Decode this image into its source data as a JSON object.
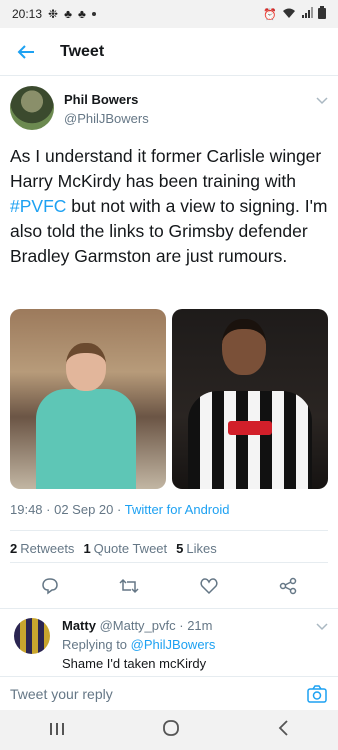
{
  "status_bar": {
    "time": "20:13"
  },
  "header": {
    "title": "Tweet"
  },
  "tweet": {
    "author_name": "Phil Bowers",
    "author_handle": "@PhilJBowers",
    "text_before": "As I understand it former Carlisle winger Harry McKirdy has been training with ",
    "hashtag": "#PVFC",
    "text_after": " but not with a view to signing. I'm also told the links to Grimsby defender Bradley Garmston are just rumours.",
    "media": [
      {
        "name": "image-left",
        "description": "Player in teal kit"
      },
      {
        "name": "image-right",
        "description": "Player in black-and-white striped kit"
      }
    ],
    "time": "19:48",
    "date": "02 Sep 20",
    "separator": " · ",
    "source": "Twitter for Android",
    "stats": {
      "retweets": "2",
      "retweets_label": "Retweets",
      "quotes": "1",
      "quotes_label": "Quote Tweet",
      "likes": "5",
      "likes_label": "Likes"
    }
  },
  "reply": {
    "name": "Matty",
    "handle": "@Matty_pvfc",
    "age": "21m",
    "replying_prefix": "Replying to ",
    "replying_to": "@PhilJBowers",
    "text": "Shame I'd taken mcKirdy"
  },
  "compose": {
    "placeholder": "Tweet your reply"
  },
  "colors": {
    "accent": "#1da1f2",
    "muted": "#657786",
    "text": "#14171a",
    "divider": "#e6ecf0"
  }
}
